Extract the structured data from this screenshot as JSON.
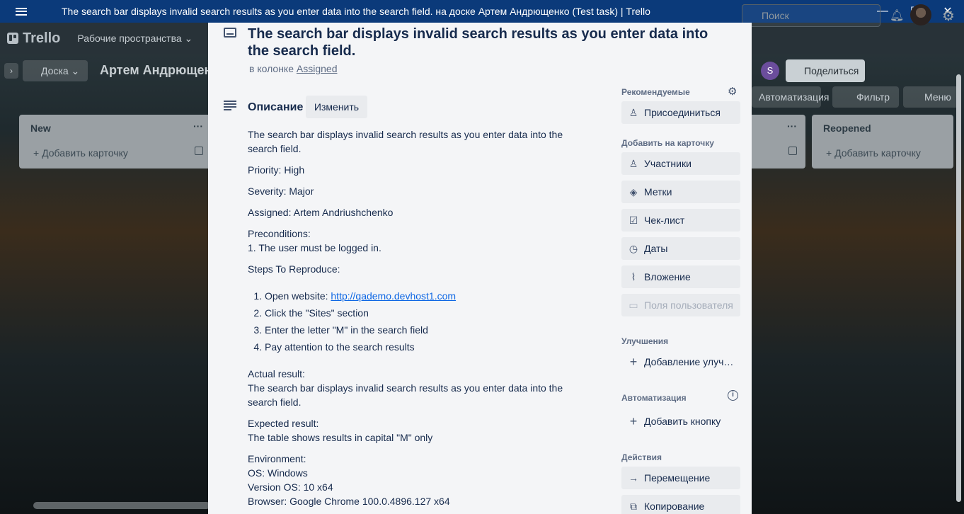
{
  "window": {
    "title": "The search bar displays invalid search results as you enter data into the search field. на доске Артем Андрющенко (Test task) | Trello",
    "minimize": "—",
    "maximize": "☐",
    "close": "✕"
  },
  "topnav": {
    "logo": "Trello",
    "workspaces": "Рабочие пространства",
    "search_placeholder": "Поиск"
  },
  "boardbar": {
    "view": "Доска",
    "board_name": "Артем Андрющенко (Test task)",
    "member_initial": "S",
    "share": "Поделиться",
    "automation": "Автоматизация",
    "filter": "Фильтр",
    "menu": "Меню"
  },
  "lists": [
    {
      "name": "New",
      "add": "Добавить карточку"
    },
    {
      "name": "",
      "add": ""
    },
    {
      "name": "Reopened",
      "add": "Добавить карточку"
    }
  ],
  "card": {
    "title": "The search bar displays invalid search results as you enter data into the search field.",
    "in_list_prefix": "в колонке",
    "list_name": "Assigned",
    "description_heading": "Описание",
    "edit_button": "Изменить",
    "description": {
      "summary": "The search bar displays invalid search results as you enter data into the search field.",
      "priority": "Priority: High",
      "severity": "Severity: Major",
      "assigned": "Assigned: Artem Andriushchenko",
      "preconditions_label": "Preconditions:",
      "preconditions_item": "1. The user must be logged in.",
      "steps_label": "Steps To Reproduce:",
      "steps": [
        "Open website: ",
        "Click the \"Sites\" section",
        "Enter the letter \"M\" in the search field",
        "Pay attention to the search results"
      ],
      "link": "http://qademo.devhost1.com",
      "actual_label": "Actual result:",
      "actual": "The search bar displays invalid search results as you enter data into the search field.",
      "expected_label": "Expected result:",
      "expected": "The table shows results in capital \"M\" only",
      "env_label": "Environment:",
      "env_os": "OS: Windows",
      "env_version": "Version OS: 10 x64",
      "env_browser": "Browser: Google Chrome 100.0.4896.127 x64"
    }
  },
  "sidebar": {
    "suggested_heading": "Рекомендуемые",
    "join": "Присоединиться",
    "add_heading": "Добавить на карточку",
    "members": "Участники",
    "labels": "Метки",
    "checklist": "Чек-лист",
    "dates": "Даты",
    "attachment": "Вложение",
    "custom_fields": "Поля пользователя",
    "powerups_heading": "Улучшения",
    "add_powerup": "Добавление улуч…",
    "automation_heading": "Автоматизация",
    "add_button": "Добавить кнопку",
    "actions_heading": "Действия",
    "move": "Перемещение",
    "copy": "Копирование"
  }
}
